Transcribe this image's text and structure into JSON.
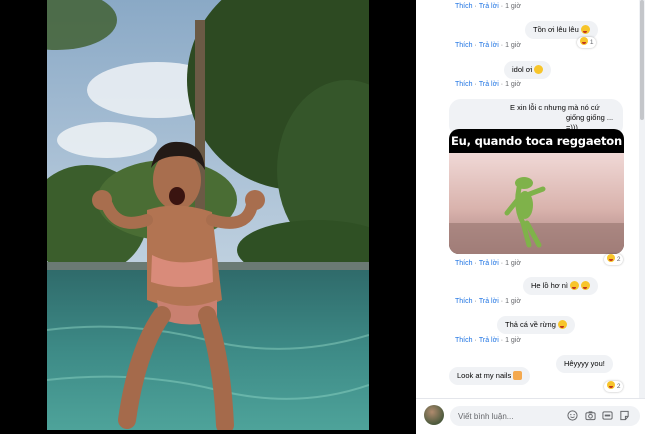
{
  "comments": [
    {
      "text": "",
      "actions": {
        "like": "Thích",
        "reply": "Trả lời",
        "time": "1 giờ"
      }
    },
    {
      "text": "Tồn ơi lêu lêu",
      "reaction_count": "1",
      "actions": {
        "like": "Thích",
        "reply": "Trả lời",
        "time": "1 giờ"
      }
    },
    {
      "text": "idol ơi",
      "actions": {
        "like": "Thích",
        "reply": "Trả lời",
        "time": "1 giờ"
      }
    },
    {
      "text": "E xin lỗi c nhưng mà nó cứ giống giống ... =)))",
      "image_caption": "Eu, quando toca reggaeton",
      "reaction_count": "2",
      "actions": {
        "like": "Thích",
        "reply": "Trả lời",
        "time": "1 giờ"
      }
    },
    {
      "text": "He lồ hơ nì",
      "actions": {
        "like": "Thích",
        "reply": "Trả lời",
        "time": "1 giờ"
      }
    },
    {
      "text": "Thả cá về rừng",
      "actions": {
        "like": "Thích",
        "reply": "Trả lời",
        "time": "1 giờ"
      }
    },
    {
      "text": "Hêyyyy you!",
      "text2": "Look at my nails",
      "reaction_count": "2",
      "actions": {
        "like": "Thích",
        "reply": "Trả lời",
        "time": "1 giờ"
      }
    }
  ],
  "composer": {
    "placeholder": "Viết bình luận..."
  },
  "icons": [
    "emoji-icon",
    "camera-icon",
    "gif-icon",
    "sticker-icon"
  ],
  "colors": {
    "link": "#1c72e3",
    "bubble": "#f0f2f5",
    "meta": "#65676b"
  }
}
